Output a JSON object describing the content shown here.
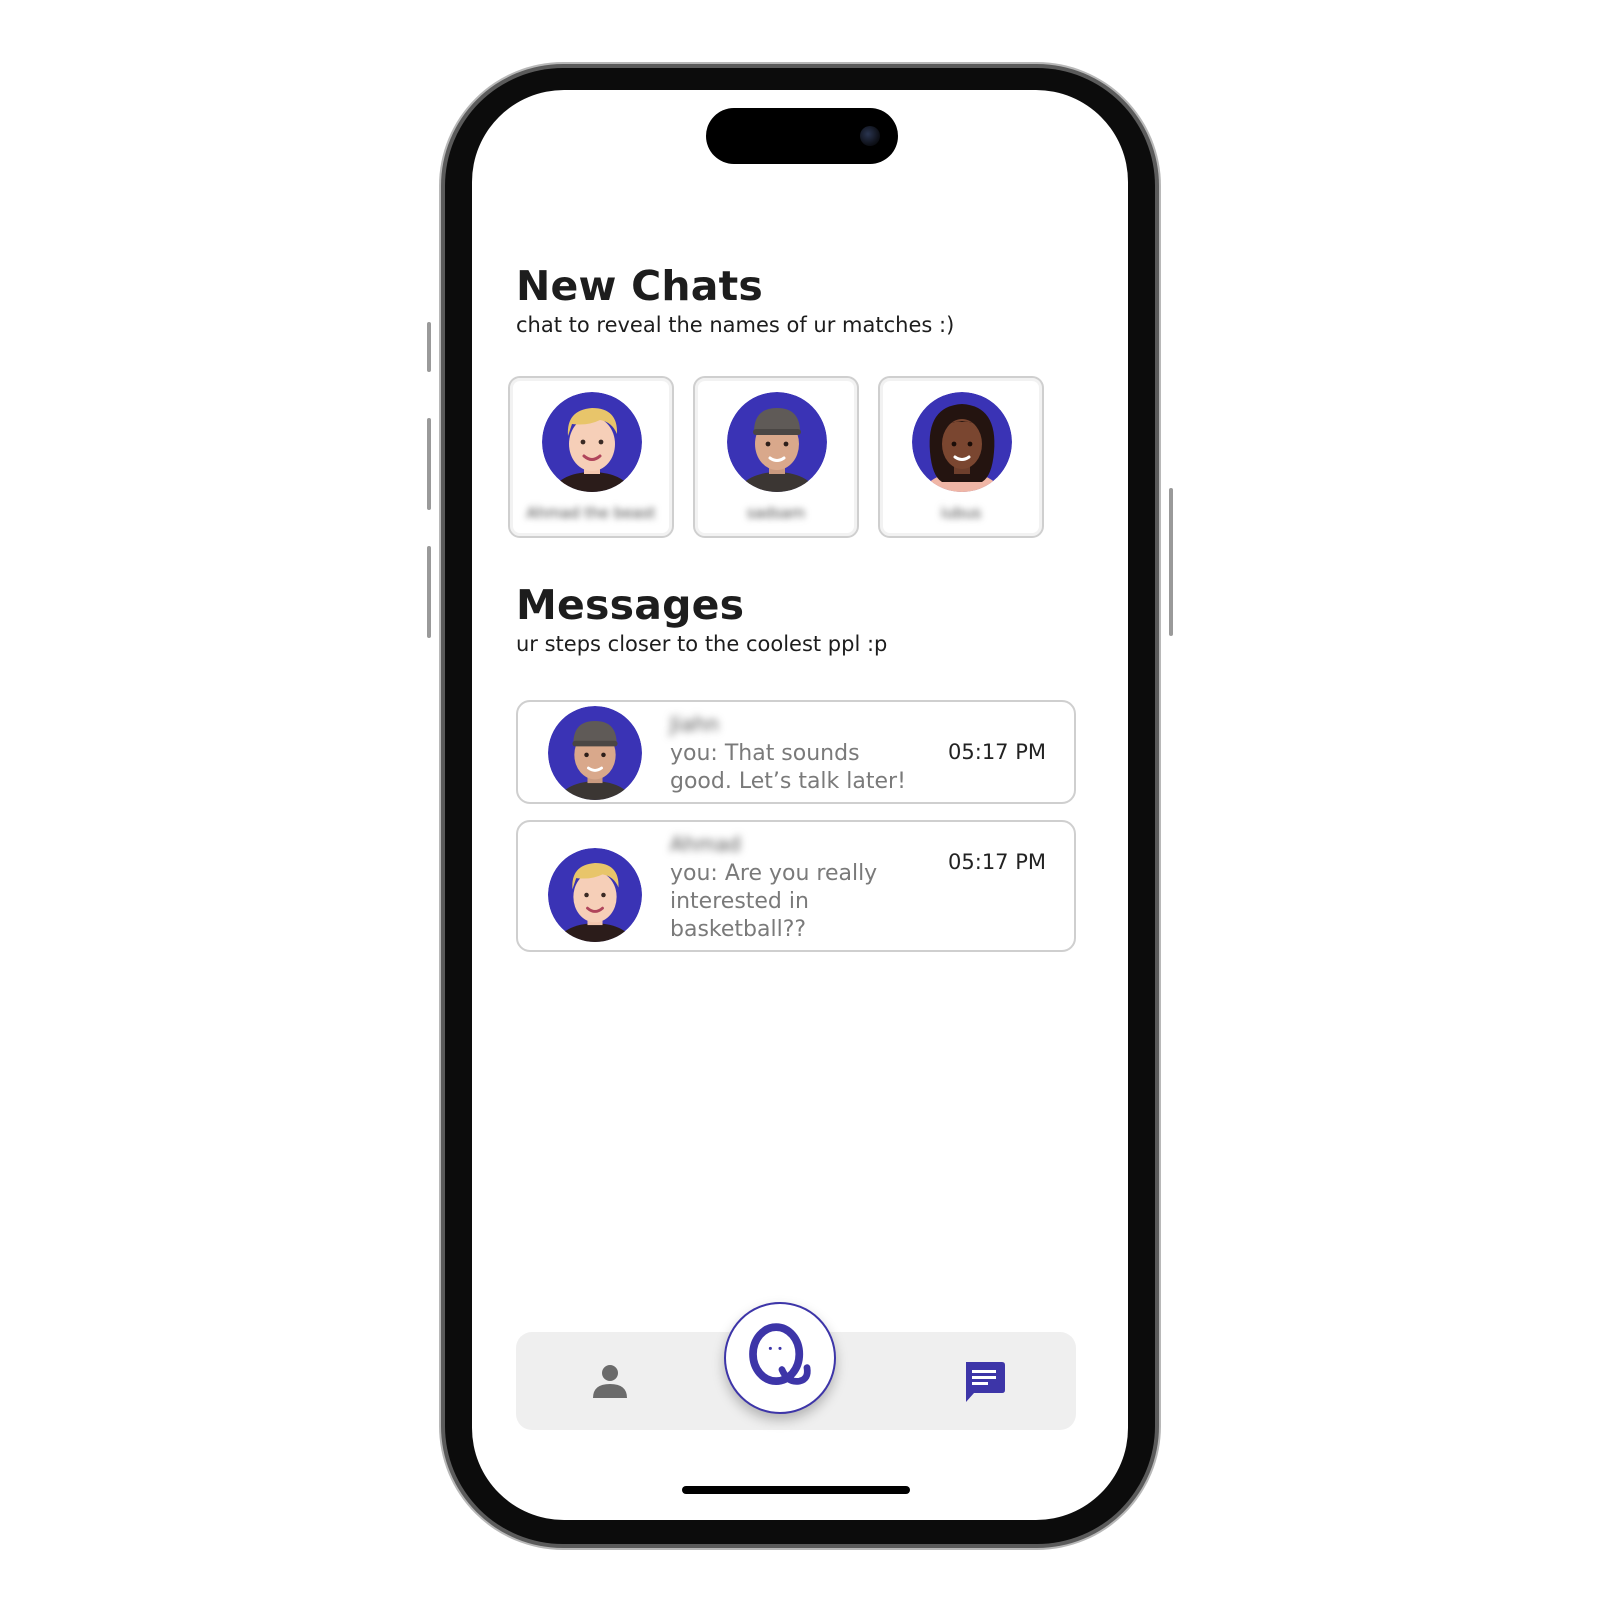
{
  "colors": {
    "accent": "#3d35a8",
    "avatar_bg": "#3a33b5",
    "text_primary": "#1d1d1d",
    "text_secondary": "#7a7a7a",
    "nav_bg": "#efefef"
  },
  "new_chats": {
    "title": "New Chats",
    "subtitle": "chat to reveal the names of ur matches :)",
    "cards": [
      {
        "avatar": "blonde-man-avatar",
        "name": "Ahmad the beast"
      },
      {
        "avatar": "cap-man-avatar",
        "name": "sadsam"
      },
      {
        "avatar": "curly-hair-woman-avatar",
        "name": "iubus"
      }
    ]
  },
  "messages": {
    "title": "Messages",
    "subtitle": "ur steps closer to the coolest ppl :p",
    "items": [
      {
        "avatar": "cap-man-avatar",
        "name": "Jiahn",
        "preview": "you: That sounds good. Let’s talk later!",
        "time": "05:17 PM"
      },
      {
        "avatar": "blonde-man-avatar",
        "name": "Ahmad",
        "preview": "you: Are you really interested in basketball??",
        "time": "05:17 PM"
      }
    ]
  },
  "bottom_nav": {
    "left_icon": "person-icon",
    "center_icon": "q-logo-icon",
    "right_icon": "chat-bubble-icon"
  }
}
